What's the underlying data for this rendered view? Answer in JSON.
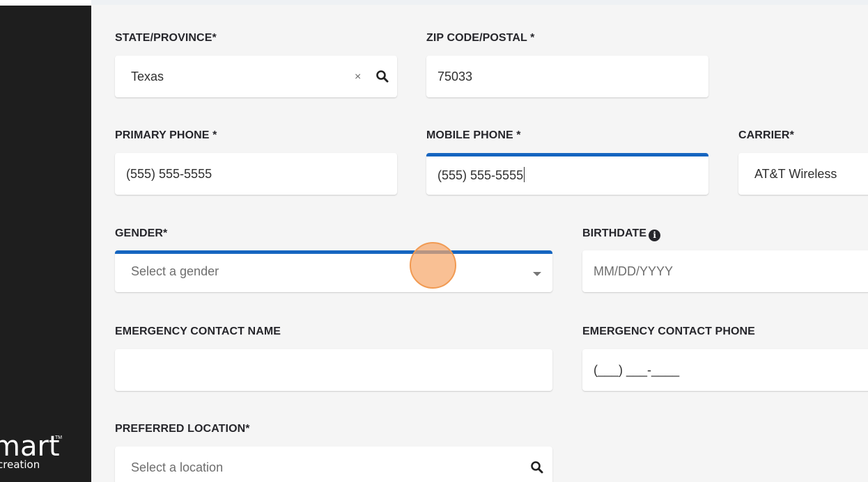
{
  "brand": {
    "word": "mart",
    "tm": "TM",
    "sub": "creation"
  },
  "form": {
    "state": {
      "label": "STATE/PROVINCE*",
      "value": "Texas",
      "clear_glyph": "×"
    },
    "zip": {
      "label": "ZIP CODE/POSTAL *",
      "value": "75033"
    },
    "primary_phone": {
      "label": "PRIMARY PHONE *",
      "value": "(555) 555-5555"
    },
    "mobile_phone": {
      "label": "MOBILE PHONE *",
      "value": "(555) 555-5555"
    },
    "carrier": {
      "label": "CARRIER*",
      "value": "AT&T Wireless"
    },
    "gender": {
      "label": "GENDER*",
      "placeholder": "Select a gender"
    },
    "birthdate": {
      "label": "BIRTHDATE",
      "info_glyph": "i",
      "placeholder": "MM/DD/YYYY"
    },
    "emergency_name": {
      "label": "EMERGENCY CONTACT NAME",
      "value": ""
    },
    "emergency_phone": {
      "label": "EMERGENCY CONTACT PHONE",
      "mask": "(___) ___-____"
    },
    "preferred_location": {
      "label": "PREFERRED LOCATION*",
      "placeholder": "Select a location"
    }
  },
  "colors": {
    "active_accent": "#1565c0",
    "click_indicator": "#f7a86b",
    "sidebar": "#1e1e1e"
  },
  "icons": [
    "clear-icon",
    "search-icon",
    "chevron-down-icon",
    "info-icon"
  ]
}
